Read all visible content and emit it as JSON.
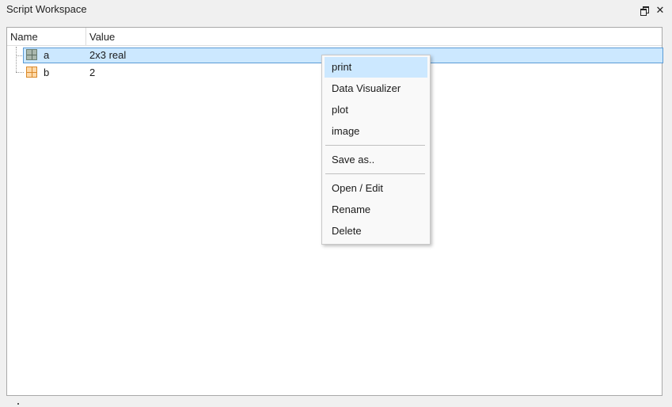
{
  "window": {
    "title": "Script Workspace",
    "float_glyph": "",
    "close_glyph": "✕"
  },
  "table": {
    "headers": {
      "name": "Name",
      "value": "Value"
    },
    "rows": [
      {
        "name": "a",
        "value": "2x3 real",
        "icon": "matrix-icon",
        "selected": true
      },
      {
        "name": "b",
        "value": "2",
        "icon": "scalar-icon",
        "selected": false
      }
    ]
  },
  "context_menu": {
    "items": [
      {
        "label": "print",
        "highlighted": true
      },
      {
        "label": "Data Visualizer"
      },
      {
        "label": "plot"
      },
      {
        "label": "image"
      },
      {
        "label": "Save as.."
      },
      {
        "label": "Open / Edit"
      },
      {
        "label": "Rename"
      },
      {
        "label": "Delete"
      }
    ]
  },
  "colors": {
    "selection": "#cce8ff",
    "selection_border": "#5b9bd5",
    "matrix_icon": "#a9b7ad",
    "scalar_icon": "#ffd9a8"
  }
}
